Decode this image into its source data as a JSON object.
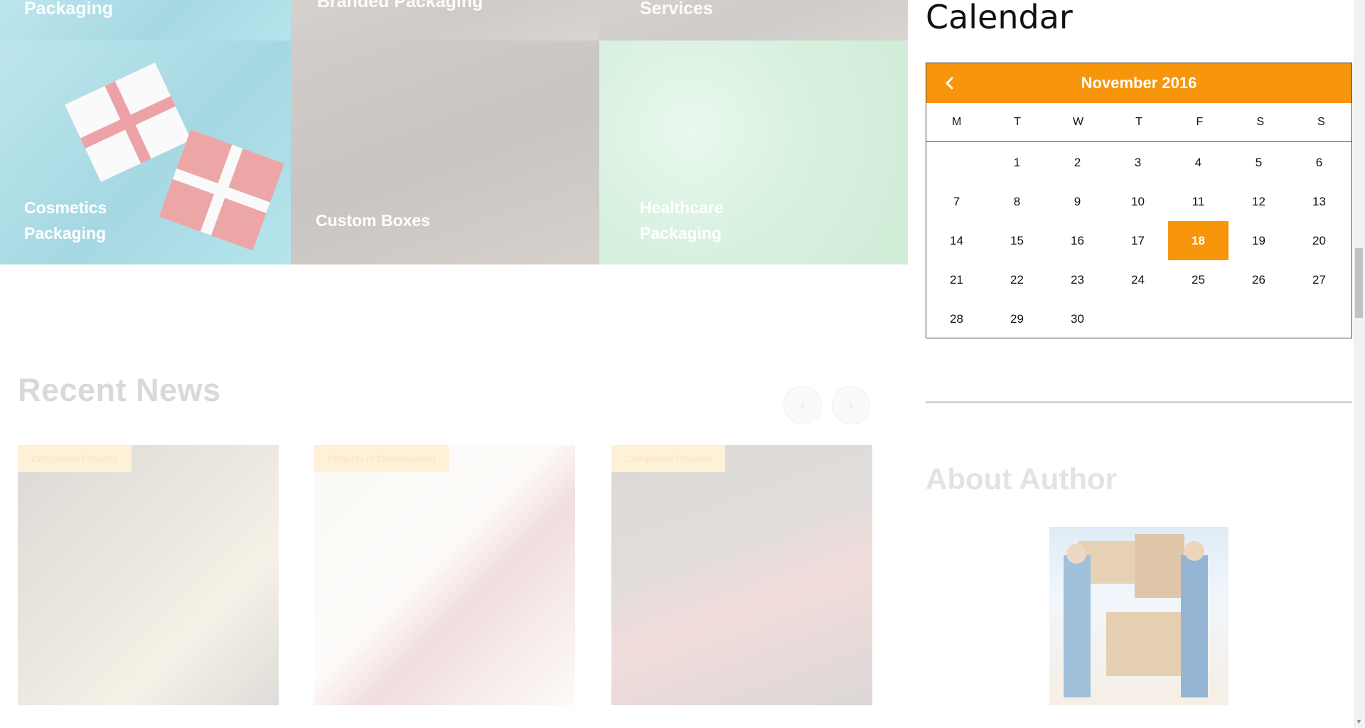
{
  "tiles_top": [
    {
      "label": "Packaging"
    },
    {
      "label": "Branded Packaging"
    },
    {
      "label": "Services"
    }
  ],
  "tiles": [
    {
      "label": "Cosmetics Packaging"
    },
    {
      "label": "Custom Boxes"
    },
    {
      "label": "Healthcare Packaging"
    }
  ],
  "news": {
    "title": "Recent News",
    "prev_icon": "chevron-left-icon",
    "next_icon": "chevron-right-icon",
    "cards": [
      {
        "badge": "Completed Projects"
      },
      {
        "badge": "Projects in Development"
      },
      {
        "badge": "Completed Projects"
      }
    ]
  },
  "sidebar": {
    "calendar_title": "Calendar",
    "calendar": {
      "month_label": "November 2016",
      "weekdays": [
        "M",
        "T",
        "W",
        "T",
        "F",
        "S",
        "S"
      ],
      "leading_blanks": 1,
      "days_in_month": 30,
      "selected_day": 18,
      "accent": "#f7950b"
    },
    "author_title": "About Author"
  }
}
